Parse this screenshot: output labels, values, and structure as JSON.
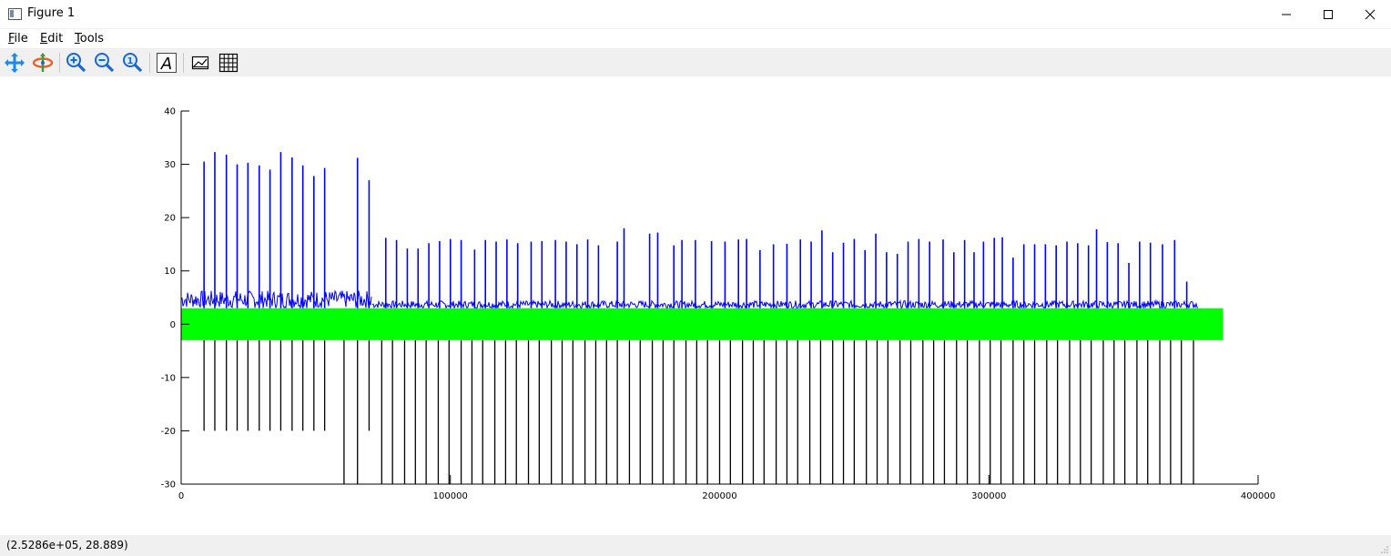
{
  "window": {
    "title": "Figure 1"
  },
  "menu": {
    "items": [
      {
        "label": "File",
        "mnemonic": "F",
        "rest": "ile"
      },
      {
        "label": "Edit",
        "mnemonic": "E",
        "rest": "dit"
      },
      {
        "label": "Tools",
        "mnemonic": "T",
        "rest": "ools"
      }
    ]
  },
  "toolbar": {
    "buttons": [
      {
        "name": "pan-icon"
      },
      {
        "name": "rotate-icon"
      },
      {
        "name": "zoom-in-icon"
      },
      {
        "name": "zoom-out-icon"
      },
      {
        "name": "zoom-reset-icon"
      },
      {
        "name": "text-icon"
      },
      {
        "name": "axes-icon"
      },
      {
        "name": "grid-icon"
      }
    ]
  },
  "status": {
    "coords": "(2.5286e+05, 28.889)"
  },
  "colors": {
    "blue_series": "#0000ff",
    "green_band": "#00ff00",
    "black_series": "#000000",
    "toolbar_bg": "#f0f0f0"
  },
  "chart_data": {
    "type": "line",
    "xlim": [
      0,
      400000
    ],
    "ylim": [
      -30,
      40
    ],
    "xticks": [
      0,
      100000,
      200000,
      300000,
      400000
    ],
    "yticks": [
      -30,
      -20,
      -10,
      0,
      10,
      20,
      30,
      40
    ],
    "xtick_labels": [
      "0",
      "100000",
      "200000",
      "300000",
      "400000"
    ],
    "ytick_labels": [
      "-30",
      "-20",
      "-10",
      "0",
      "10",
      "20",
      "30",
      "40"
    ],
    "grid": false,
    "series": [
      {
        "color": "#0000ff",
        "description_kind": "spikes",
        "baseline_segments": [
          {
            "x0": 0,
            "x1": 71000,
            "y": 4.5
          },
          {
            "x0": 71000,
            "x1": 378000,
            "y": 3.5
          }
        ],
        "spikes": [
          {
            "x": 8500,
            "y": 30.5
          },
          {
            "x": 12500,
            "y": 32.3
          },
          {
            "x": 16800,
            "y": 31.8
          },
          {
            "x": 20800,
            "y": 30.0
          },
          {
            "x": 24800,
            "y": 30.3
          },
          {
            "x": 29000,
            "y": 29.8
          },
          {
            "x": 33000,
            "y": 29.0
          },
          {
            "x": 37000,
            "y": 32.3
          },
          {
            "x": 41200,
            "y": 31.3
          },
          {
            "x": 45200,
            "y": 29.8
          },
          {
            "x": 49300,
            "y": 27.8
          },
          {
            "x": 53300,
            "y": 29.3
          },
          {
            "x": 65500,
            "y": 31.2
          },
          {
            "x": 69800,
            "y": 27.0
          },
          {
            "x": 76000,
            "y": 16.2
          },
          {
            "x": 80000,
            "y": 15.8
          },
          {
            "x": 84000,
            "y": 14.2
          },
          {
            "x": 88000,
            "y": 14.2
          },
          {
            "x": 92000,
            "y": 15.2
          },
          {
            "x": 96000,
            "y": 15.6
          },
          {
            "x": 100000,
            "y": 16.0
          },
          {
            "x": 104000,
            "y": 15.8
          },
          {
            "x": 109000,
            "y": 14.0
          },
          {
            "x": 113000,
            "y": 15.8
          },
          {
            "x": 117000,
            "y": 15.5
          },
          {
            "x": 121000,
            "y": 15.9
          },
          {
            "x": 125000,
            "y": 15.2
          },
          {
            "x": 130000,
            "y": 15.5
          },
          {
            "x": 134000,
            "y": 15.6
          },
          {
            "x": 139000,
            "y": 15.8
          },
          {
            "x": 143000,
            "y": 15.5
          },
          {
            "x": 147000,
            "y": 15.0
          },
          {
            "x": 151000,
            "y": 15.9
          },
          {
            "x": 155000,
            "y": 14.8
          },
          {
            "x": 162000,
            "y": 15.5
          },
          {
            "x": 164500,
            "y": 18.0
          },
          {
            "x": 174000,
            "y": 17.0
          },
          {
            "x": 177000,
            "y": 17.2
          },
          {
            "x": 183000,
            "y": 14.8
          },
          {
            "x": 186000,
            "y": 15.8
          },
          {
            "x": 191000,
            "y": 15.8
          },
          {
            "x": 197000,
            "y": 15.6
          },
          {
            "x": 202000,
            "y": 15.5
          },
          {
            "x": 207000,
            "y": 15.9
          },
          {
            "x": 210000,
            "y": 16.0
          },
          {
            "x": 215000,
            "y": 13.9
          },
          {
            "x": 220000,
            "y": 15.0
          },
          {
            "x": 225000,
            "y": 15.1
          },
          {
            "x": 230000,
            "y": 15.9
          },
          {
            "x": 234000,
            "y": 15.5
          },
          {
            "x": 238000,
            "y": 17.6
          },
          {
            "x": 242000,
            "y": 13.5
          },
          {
            "x": 246000,
            "y": 15.3
          },
          {
            "x": 250000,
            "y": 16.0
          },
          {
            "x": 254000,
            "y": 13.9
          },
          {
            "x": 258000,
            "y": 17.0
          },
          {
            "x": 262000,
            "y": 13.5
          },
          {
            "x": 266000,
            "y": 13.2
          },
          {
            "x": 270000,
            "y": 15.5
          },
          {
            "x": 274000,
            "y": 16.0
          },
          {
            "x": 278000,
            "y": 15.5
          },
          {
            "x": 283000,
            "y": 15.9
          },
          {
            "x": 287000,
            "y": 13.5
          },
          {
            "x": 291000,
            "y": 15.8
          },
          {
            "x": 294500,
            "y": 13.5
          },
          {
            "x": 298000,
            "y": 15.5
          },
          {
            "x": 302000,
            "y": 16.2
          },
          {
            "x": 305000,
            "y": 16.3
          },
          {
            "x": 309000,
            "y": 12.5
          },
          {
            "x": 313000,
            "y": 15.0
          },
          {
            "x": 317000,
            "y": 15.0
          },
          {
            "x": 321000,
            "y": 15.0
          },
          {
            "x": 325000,
            "y": 14.8
          },
          {
            "x": 329000,
            "y": 15.5
          },
          {
            "x": 333000,
            "y": 15.2
          },
          {
            "x": 337000,
            "y": 14.8
          },
          {
            "x": 340000,
            "y": 17.8
          },
          {
            "x": 344000,
            "y": 15.4
          },
          {
            "x": 348000,
            "y": 15.2
          },
          {
            "x": 352000,
            "y": 11.5
          },
          {
            "x": 356000,
            "y": 15.5
          },
          {
            "x": 360000,
            "y": 15.3
          },
          {
            "x": 364500,
            "y": 15.0
          },
          {
            "x": 369000,
            "y": 15.8
          },
          {
            "x": 373500,
            "y": 8.0
          }
        ]
      },
      {
        "color": "#00ff00",
        "description_kind": "band",
        "x0": 0,
        "x1": 387000,
        "ymin": -3,
        "ymax": 3
      },
      {
        "color": "#000000",
        "description_kind": "drops",
        "drops": [
          {
            "x": 8500,
            "y": -20
          },
          {
            "x": 12500,
            "y": -20
          },
          {
            "x": 16800,
            "y": -20
          },
          {
            "x": 20800,
            "y": -20
          },
          {
            "x": 24800,
            "y": -20
          },
          {
            "x": 29000,
            "y": -20
          },
          {
            "x": 33000,
            "y": -20
          },
          {
            "x": 37000,
            "y": -20
          },
          {
            "x": 41200,
            "y": -20
          },
          {
            "x": 45200,
            "y": -20
          },
          {
            "x": 49300,
            "y": -20
          },
          {
            "x": 53300,
            "y": -20
          },
          {
            "x": 60500,
            "y": -30
          },
          {
            "x": 65500,
            "y": -30
          },
          {
            "x": 69800,
            "y": -20
          },
          {
            "x": 74500,
            "y": -30
          },
          {
            "x": 78500,
            "y": -30
          },
          {
            "x": 83000,
            "y": -30
          },
          {
            "x": 87000,
            "y": -30
          },
          {
            "x": 91000,
            "y": -30
          },
          {
            "x": 95500,
            "y": -30
          },
          {
            "x": 99500,
            "y": -30
          },
          {
            "x": 104000,
            "y": -30
          },
          {
            "x": 108000,
            "y": -30
          },
          {
            "x": 112000,
            "y": -30
          },
          {
            "x": 116500,
            "y": -30
          },
          {
            "x": 120500,
            "y": -30
          },
          {
            "x": 124500,
            "y": -30
          },
          {
            "x": 129000,
            "y": -30
          },
          {
            "x": 133000,
            "y": -30
          },
          {
            "x": 137500,
            "y": -30
          },
          {
            "x": 141500,
            "y": -30
          },
          {
            "x": 145500,
            "y": -30
          },
          {
            "x": 150000,
            "y": -30
          },
          {
            "x": 154000,
            "y": -30
          },
          {
            "x": 158000,
            "y": -30
          },
          {
            "x": 162000,
            "y": -30
          },
          {
            "x": 166500,
            "y": -30
          },
          {
            "x": 170500,
            "y": -30
          },
          {
            "x": 175000,
            "y": -30
          },
          {
            "x": 179000,
            "y": -30
          },
          {
            "x": 183000,
            "y": -30
          },
          {
            "x": 187500,
            "y": -30
          },
          {
            "x": 191500,
            "y": -30
          },
          {
            "x": 195500,
            "y": -30
          },
          {
            "x": 200000,
            "y": -30
          },
          {
            "x": 204000,
            "y": -30
          },
          {
            "x": 208500,
            "y": -30
          },
          {
            "x": 212500,
            "y": -30
          },
          {
            "x": 216500,
            "y": -30
          },
          {
            "x": 221000,
            "y": -30
          },
          {
            "x": 225000,
            "y": -30
          },
          {
            "x": 229000,
            "y": -30
          },
          {
            "x": 233500,
            "y": -30
          },
          {
            "x": 237500,
            "y": -30
          },
          {
            "x": 242000,
            "y": -30
          },
          {
            "x": 246000,
            "y": -30
          },
          {
            "x": 250000,
            "y": -30
          },
          {
            "x": 254500,
            "y": -30
          },
          {
            "x": 258500,
            "y": -30
          },
          {
            "x": 262500,
            "y": -30
          },
          {
            "x": 267000,
            "y": -30
          },
          {
            "x": 271000,
            "y": -30
          },
          {
            "x": 275500,
            "y": -30
          },
          {
            "x": 279500,
            "y": -30
          },
          {
            "x": 283500,
            "y": -30
          },
          {
            "x": 288000,
            "y": -30
          },
          {
            "x": 292000,
            "y": -30
          },
          {
            "x": 296500,
            "y": -30
          },
          {
            "x": 300500,
            "y": -30
          },
          {
            "x": 304500,
            "y": -30
          },
          {
            "x": 309000,
            "y": -30
          },
          {
            "x": 313000,
            "y": -30
          },
          {
            "x": 317000,
            "y": -30
          },
          {
            "x": 321500,
            "y": -30
          },
          {
            "x": 325500,
            "y": -30
          },
          {
            "x": 330000,
            "y": -30
          },
          {
            "x": 334000,
            "y": -30
          },
          {
            "x": 338000,
            "y": -30
          },
          {
            "x": 342500,
            "y": -30
          },
          {
            "x": 346500,
            "y": -30
          },
          {
            "x": 350500,
            "y": -30
          },
          {
            "x": 355000,
            "y": -30
          },
          {
            "x": 359000,
            "y": -30
          },
          {
            "x": 363500,
            "y": -30
          },
          {
            "x": 367500,
            "y": -30
          },
          {
            "x": 371500,
            "y": -30
          },
          {
            "x": 376000,
            "y": -30
          }
        ]
      }
    ]
  }
}
